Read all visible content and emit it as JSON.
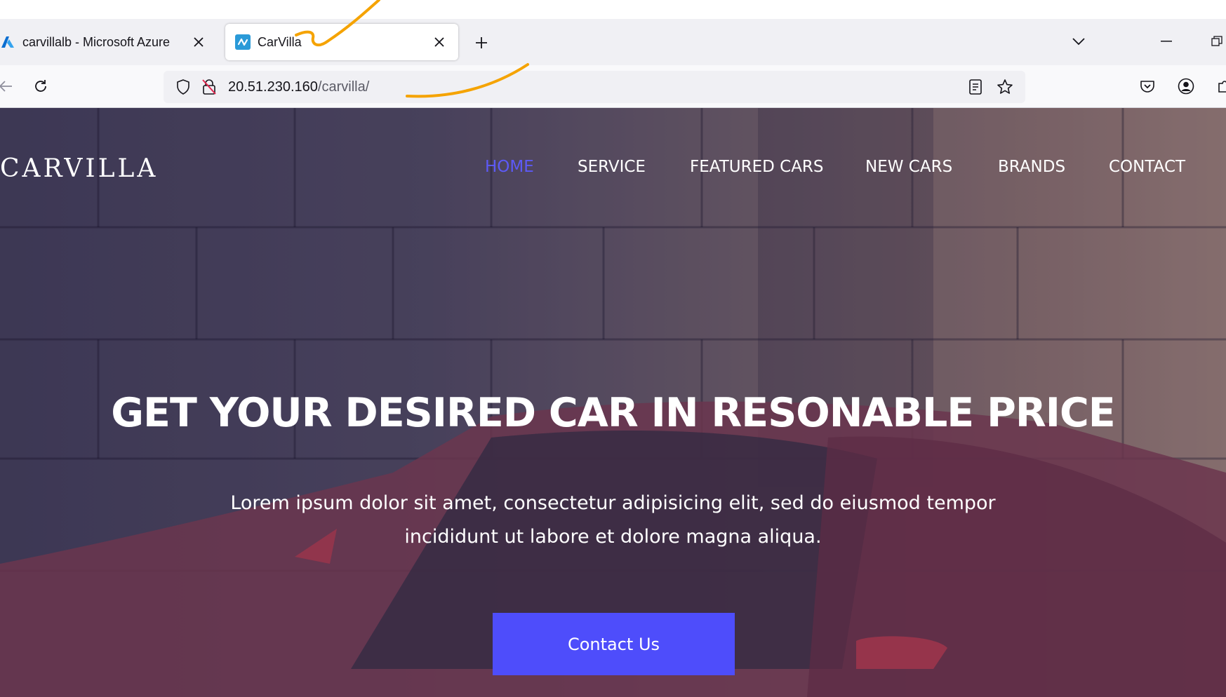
{
  "browser": {
    "tabs": [
      {
        "title": "carvillalb - Microsoft Azure",
        "icon": "azure-icon",
        "active": false
      },
      {
        "title": "CarVilla",
        "icon": "carvilla-favicon",
        "active": true
      }
    ],
    "address": {
      "host": "20.51.230.160",
      "path": "/carvilla/"
    },
    "icons": {
      "new_tab": "plus-icon",
      "tab_list": "chevron-down-icon",
      "back": "back-arrow-icon",
      "reload": "reload-icon",
      "tracking": "shield-icon",
      "insecure": "insecure-lock-icon",
      "reader": "reader-view-icon",
      "bookmark": "star-icon",
      "pocket": "pocket-icon",
      "account": "account-icon",
      "extensions": "puzzle-icon"
    }
  },
  "site": {
    "brand": "CARVILLA",
    "menu": [
      {
        "label": "HOME",
        "active": true
      },
      {
        "label": "SERVICE",
        "active": false
      },
      {
        "label": "FEATURED CARS",
        "active": false
      },
      {
        "label": "NEW CARS",
        "active": false
      },
      {
        "label": "BRANDS",
        "active": false
      },
      {
        "label": "CONTACT",
        "active": false
      }
    ],
    "hero": {
      "headline": "GET YOUR DESIRED CAR IN RESONABLE PRICE",
      "subline_1": "Lorem ipsum dolor sit amet, consectetur adipisicing elit, sed do eiusmod tempor",
      "subline_2": "incididunt ut labore et dolore magna aliqua.",
      "cta": "Contact Us"
    }
  },
  "colors": {
    "accent": "#4e4dfb",
    "menu_active": "#5d5af7",
    "annotation": "#f5a300"
  }
}
